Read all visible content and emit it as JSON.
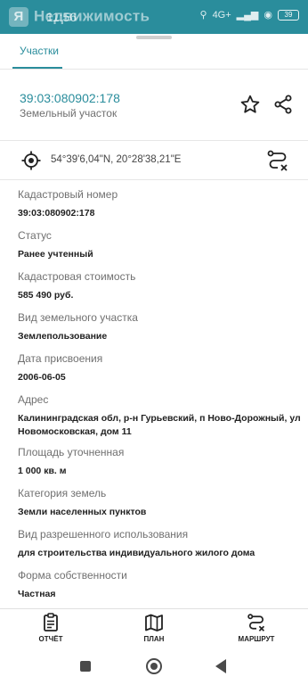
{
  "status_bar": {
    "app_name": "Недвижимость",
    "logo_letter": "Я",
    "time": "11:56",
    "battery": "39",
    "network": "4G+"
  },
  "tabs": [
    {
      "label": "Участки",
      "active": true
    }
  ],
  "parcel": {
    "id": "39:03:080902:178",
    "type": "Земельный участок"
  },
  "coordinates": "54°39'6,04\"N, 20°28'38,21\"E",
  "fields": [
    {
      "label": "Кадастровый номер",
      "value": "39:03:080902:178"
    },
    {
      "label": "Статус",
      "value": "Ранее учтенный"
    },
    {
      "label": "Кадастровая стоимость",
      "value": "585 490 руб."
    },
    {
      "label": "Вид земельного участка",
      "value": "Землепользование"
    },
    {
      "label": "Дата присвоения",
      "value": "2006-06-05"
    },
    {
      "label": "Адрес",
      "value": "Калининградская обл, р-н Гурьевский, п Ново-Дорожный, ул Новомосковская, дом 11"
    },
    {
      "label": "Площадь уточненная",
      "value": "1 000 кв. м"
    },
    {
      "label": "Категория земель",
      "value": "Земли населенных пунктов"
    },
    {
      "label": "Вид разрешенного использования",
      "value": "для строительства индивидуального жилого дома"
    },
    {
      "label": "Форма собственности",
      "value": "Частная"
    }
  ],
  "actions": [
    {
      "label": "ОТЧЁТ",
      "icon": "report-icon"
    },
    {
      "label": "ПЛАН",
      "icon": "map-icon"
    },
    {
      "label": "МАРШРУТ",
      "icon": "route-icon"
    }
  ],
  "colors": {
    "accent": "#2a8d9c",
    "text": "#212121",
    "muted": "#707070"
  }
}
